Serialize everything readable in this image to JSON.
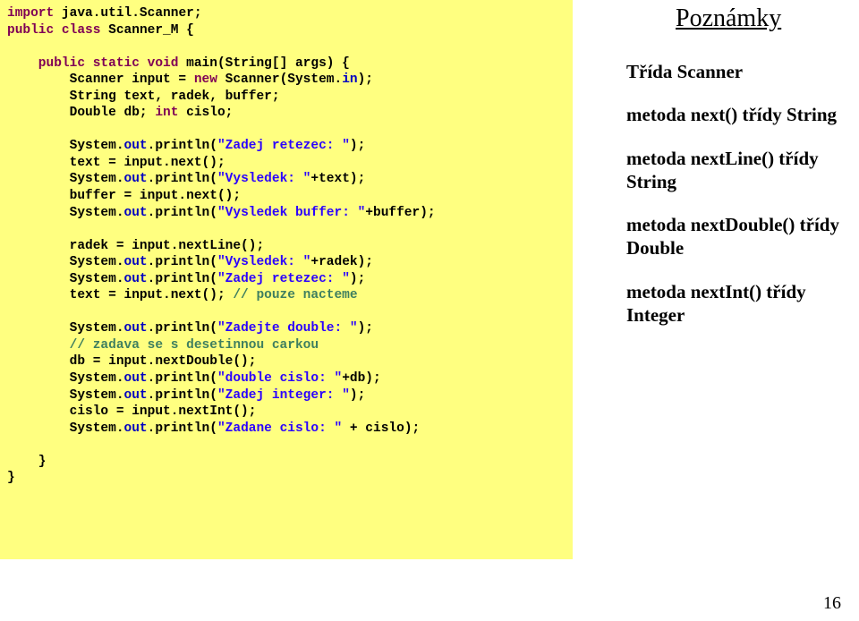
{
  "sidebar": {
    "title": "Poznámky",
    "notes": [
      {
        "bold": "Třída Scanner",
        "plain": ""
      },
      {
        "bold": "metoda next() třídy String",
        "plain": ""
      },
      {
        "bold": "metoda nextLine() třídy String",
        "plain": ""
      },
      {
        "bold": "metoda nextDouble() třídy Double",
        "plain": ""
      },
      {
        "bold": "metoda nextInt() třídy Integer",
        "plain": ""
      }
    ]
  },
  "code": {
    "l01a": "import",
    "l01b": " java.util.Scanner;",
    "l02a": "public",
    "l02b": " ",
    "l02c": "class",
    "l02d": " Scanner_M {",
    "l03": "",
    "l04a": "    public",
    "l04b": " ",
    "l04c": "static",
    "l04d": " ",
    "l04e": "void",
    "l04f": " main(String[] args) {",
    "l05a": "        Scanner input = ",
    "l05b": "new",
    "l05c": " Scanner(System.",
    "l05d": "in",
    "l05e": ");",
    "l06": "        String text, radek, buffer;",
    "l07a": "        Double db; ",
    "l07b": "int",
    "l07c": " cislo;",
    "l08": "",
    "l09a": "        System.",
    "l09b": "out",
    "l09c": ".println(",
    "l09d": "\"Zadej retezec: \"",
    "l09e": ");",
    "l10": "        text = input.next();",
    "l11a": "        System.",
    "l11b": "out",
    "l11c": ".println(",
    "l11d": "\"Vysledek: \"",
    "l11e": "+text);",
    "l12": "        buffer = input.next();",
    "l13a": "        System.",
    "l13b": "out",
    "l13c": ".println(",
    "l13d": "\"Vysledek buffer: \"",
    "l13e": "+buffer);",
    "l14": "",
    "l15": "        radek = input.nextLine();",
    "l16a": "        System.",
    "l16b": "out",
    "l16c": ".println(",
    "l16d": "\"Vysledek: \"",
    "l16e": "+radek);",
    "l17a": "        System.",
    "l17b": "out",
    "l17c": ".println(",
    "l17d": "\"Zadej retezec: \"",
    "l17e": ");",
    "l18a": "        text = input.next(); ",
    "l18b": "// pouze nacteme",
    "l19": "",
    "l20a": "        System.",
    "l20b": "out",
    "l20c": ".println(",
    "l20d": "\"Zadejte double: \"",
    "l20e": ");",
    "l21": "        // zadava se s desetinnou carkou",
    "l22": "        db = input.nextDouble();",
    "l23a": "        System.",
    "l23b": "out",
    "l23c": ".println(",
    "l23d": "\"double cislo: \"",
    "l23e": "+db);",
    "l24a": "        System.",
    "l24b": "out",
    "l24c": ".println(",
    "l24d": "\"Zadej integer: \"",
    "l24e": ");",
    "l25": "        cislo = input.nextInt();",
    "l26a": "        System.",
    "l26b": "out",
    "l26c": ".println(",
    "l26d": "\"Zadane cislo: \"",
    "l26e": " + cislo);",
    "l27": "",
    "l28": "    }",
    "l29": "}"
  },
  "pageNumber": "16"
}
